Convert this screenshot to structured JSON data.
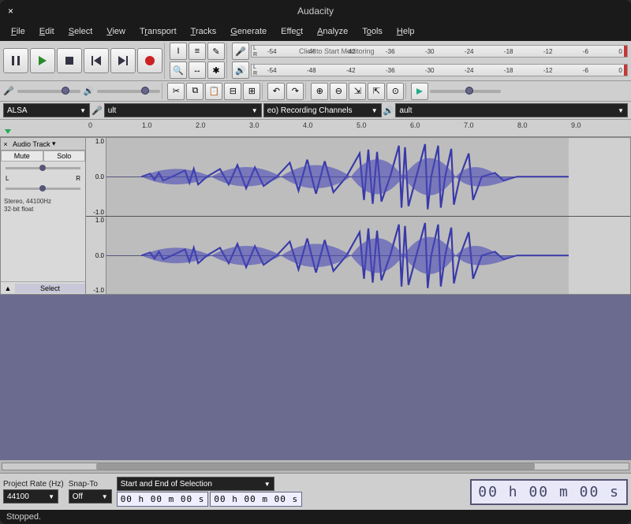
{
  "titlebar": {
    "title": "Audacity"
  },
  "menu": {
    "file": "File",
    "edit": "Edit",
    "select": "Select",
    "view": "View",
    "transport": "Transport",
    "tracks": "Tracks",
    "generate": "Generate",
    "effect": "Effect",
    "analyze": "Analyze",
    "tools": "Tools",
    "help": "Help"
  },
  "meter": {
    "rec_hint": "Click to Start Monitoring",
    "ticks": [
      "-54",
      "-48",
      "-42",
      "-36",
      "-30",
      "-24",
      "-18",
      "-12",
      "-6",
      "0"
    ],
    "L": "L",
    "R": "R"
  },
  "device": {
    "host": "ALSA",
    "in_suffix": "ult",
    "channels_label": "eo) Recording Channels",
    "out_suffix": "ault"
  },
  "ruler": {
    "ticks": [
      "0",
      "1.0",
      "2.0",
      "3.0",
      "4.0",
      "5.0",
      "6.0",
      "7.0",
      "8.0",
      "9.0"
    ]
  },
  "track": {
    "name": "Audio Track",
    "mute": "Mute",
    "solo": "Solo",
    "L": "L",
    "R": "R",
    "info1": "Stereo, 44100Hz",
    "info2": "32-bit float",
    "select": "Select",
    "vscale": {
      "top": "1.0",
      "mid": "0.0",
      "bot": "-1.0"
    }
  },
  "bottom": {
    "projrate_lbl": "Project Rate (Hz)",
    "projrate_val": "44100",
    "snap_lbl": "Snap-To",
    "snap_val": "Off",
    "sel_label": "Start and End of Selection",
    "time1": "00 h 00 m 00 s",
    "time2": "00 h 00 m 00 s",
    "bigtime": "00 h 00 m 00 s"
  },
  "status": "Stopped."
}
